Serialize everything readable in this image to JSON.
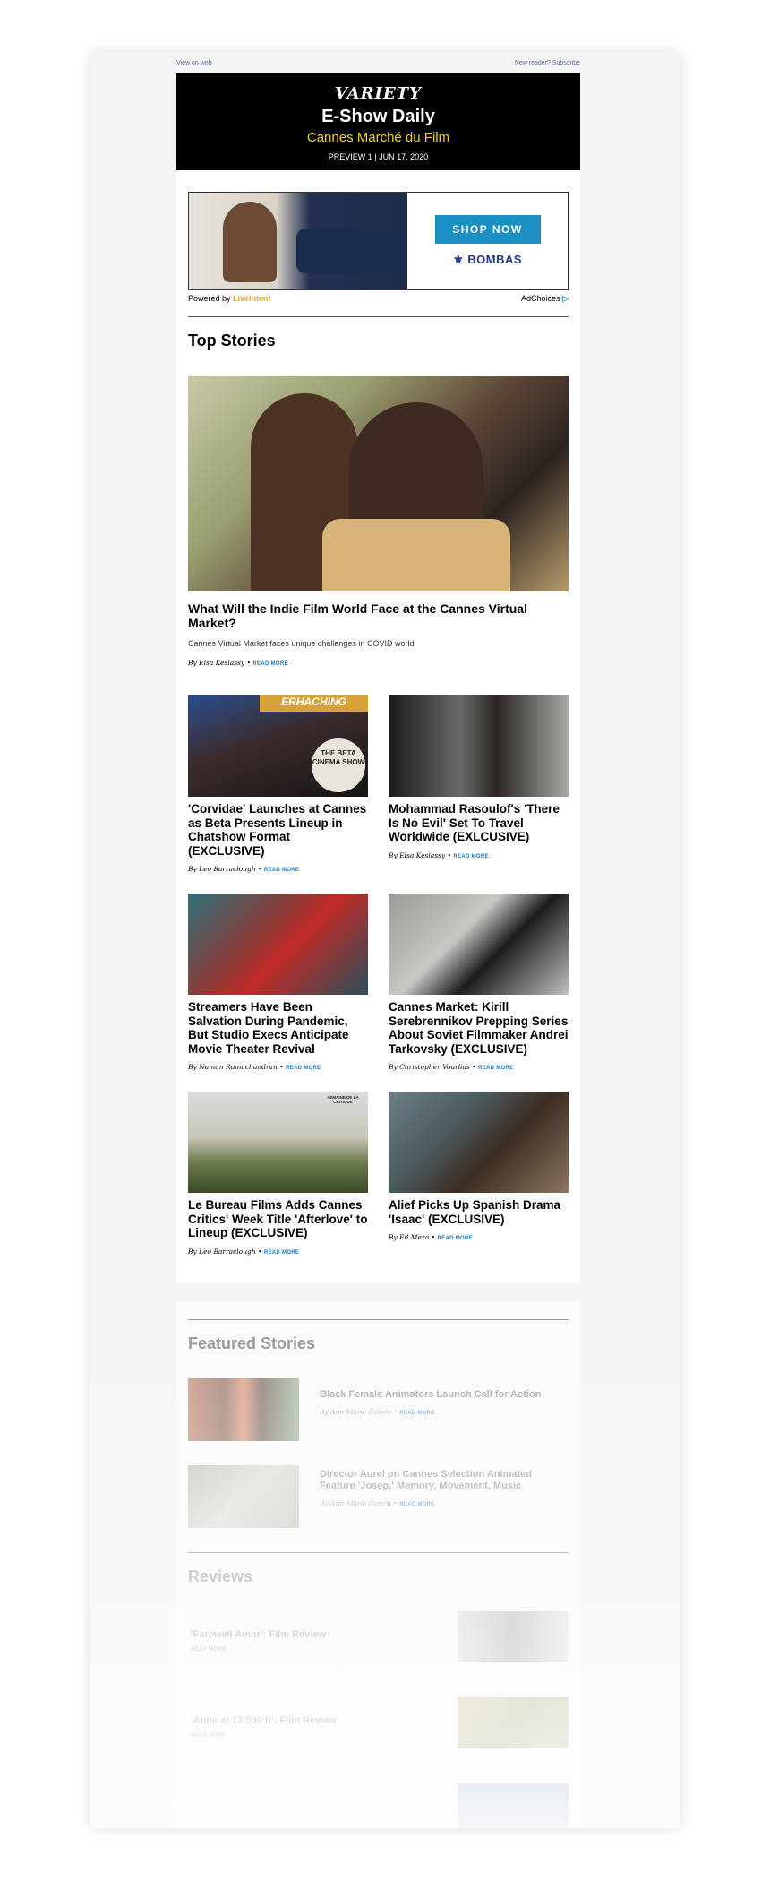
{
  "preheader": {
    "view_on_web": "View on web",
    "subscribe": "New reader? Subscribe"
  },
  "masthead": {
    "logo": "VARIETY",
    "title": "E-Show Daily",
    "subtitle": "Cannes Marché du Film",
    "issue": "PREVIEW 1 | JUN 17, 2020"
  },
  "ad": {
    "cta": "SHOP NOW",
    "brand": "BOMBAS",
    "powered_by": "Powered by",
    "powered_brand": "LiveIntent",
    "adchoices": "AdChoices"
  },
  "top_stories": {
    "title": "Top Stories",
    "hero": {
      "headline": "What Will the Indie Film World Face at the Cannes Virtual Market?",
      "dek": "Cannes Virtual Market faces unique challenges in COVID world",
      "byline": "By Elsa Keslassy",
      "read_more": "READ MORE"
    },
    "cards": [
      {
        "headline": "'Corvidae' Launches at Cannes as Beta Presents Lineup in Chatshow Format (EXCLUSIVE)",
        "byline": "By Leo Barraclough",
        "read_more": "READ MORE",
        "overlay_top": "ERHACHING",
        "overlay_badge": "THE BETA CINEMA SHOW"
      },
      {
        "headline": "Mohammad Rasoulof's 'There Is No Evil' Set To Travel Worldwide (EXLCUSIVE)",
        "byline": "By Elsa Keslassy",
        "read_more": "READ MORE"
      },
      {
        "headline": "Streamers Have Been Salvation During Pandemic, But Studio Execs Anticipate Movie Theater Revival",
        "byline": "By Naman Ramachandran",
        "read_more": "READ MORE"
      },
      {
        "headline": "Cannes Market: Kirill Serebrennikov Prepping Series About Soviet Filmmaker Andrei Tarkovsky (EXCLUSIVE)",
        "byline": "By Christopher Vourlias",
        "read_more": "READ MORE"
      },
      {
        "headline": "Le Bureau Films Adds Cannes Critics' Week Title 'Afterlove' to Lineup (EXCLUSIVE)",
        "byline": "By Leo Barraclough",
        "read_more": "READ MORE",
        "overlay_logo": "SEMAINE DE LA CRITIQUE"
      },
      {
        "headline": "Alief Picks Up Spanish Drama 'Isaac' (EXCLUSIVE)",
        "byline": "By Ed Meza",
        "read_more": "READ MORE"
      }
    ]
  },
  "featured": {
    "title": "Featured Stories",
    "items": [
      {
        "headline": "Black Female Animators Launch Call for Action",
        "byline": "By Ann-Marie Corvin",
        "read_more": "READ MORE"
      },
      {
        "headline": "Director Aurel on Cannes Selection Animated Feature 'Josep,' Memory, Movement, Music",
        "byline": "By Ann-Marie Corvin",
        "read_more": "READ MORE"
      }
    ]
  },
  "reviews": {
    "title": "Reviews",
    "items": [
      {
        "headline": "'Farewell Amor': Film Review",
        "read_more": "READ MORE"
      },
      {
        "headline": "'Anne at 13,000 ft': Film Review",
        "read_more": "READ MORE"
      }
    ]
  }
}
